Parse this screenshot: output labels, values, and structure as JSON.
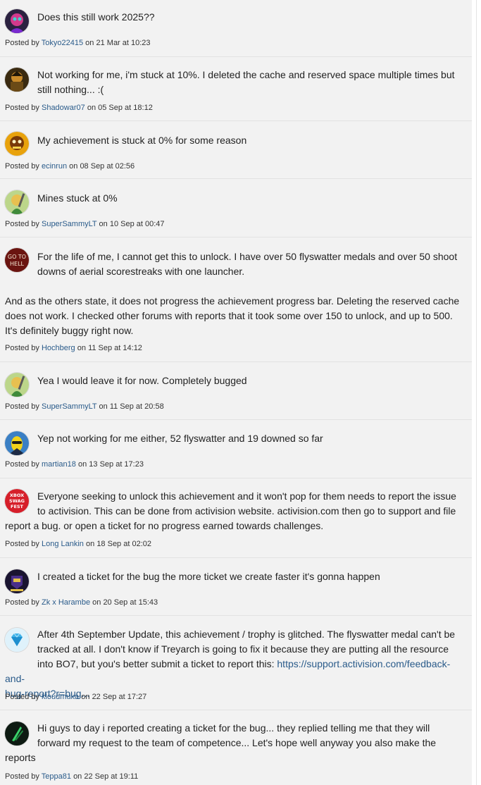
{
  "posted_by_prefix": "Posted by",
  "on_word": "on",
  "comments": [
    {
      "user": "Tokyo22415",
      "date": "21 Mar at 10:23",
      "avatar_icon": "anime-character-avatar-icon",
      "line1": "Does this still work 2025??"
    },
    {
      "user": "Shadowar07",
      "date": "05 Sep at 18:12",
      "avatar_icon": "soldier-avatar-icon",
      "line1": "Not working for me, i'm stuck at 10%. I deleted the cache and reserved space multiple times but",
      "line2": "still nothing... :("
    },
    {
      "user": "ecinrun",
      "date": "08 Sep at 02:56",
      "avatar_icon": "cartoon-avatar-icon",
      "line1": "My achievement is stuck at 0% for some reason"
    },
    {
      "user": "SuperSammyLT",
      "date": "10 Sep at 00:47",
      "avatar_icon": "warrior-avatar-icon",
      "line1": "Mines stuck at 0%"
    },
    {
      "user": "Hochberg",
      "date": "11 Sep at 14:12",
      "avatar_icon": "go-to-hell-avatar-icon",
      "avatar_text1": "GO TO",
      "avatar_text2": "HELL",
      "line1": "For the life of me, I cannot get this to unlock. I have over 50 flyswatter medals and over 50 shoot",
      "line2": "downs of aerial scorestreaks with one launcher.",
      "line3": "And as the others state, it does not progress the achievement progress bar. Deleting the reserved cache",
      "line4": "does not work. I checked other forums with reports that it took some over 150 to unlock, and up to 500.",
      "line5": "It's definitely buggy right now."
    },
    {
      "user": "SuperSammyLT",
      "date": "11 Sep at 20:58",
      "avatar_icon": "warrior-avatar-icon",
      "line1": "Yea I would leave it for now. Completely bugged"
    },
    {
      "user": "martian18",
      "date": "13 Sep at 17:23",
      "avatar_icon": "alien-avatar-icon",
      "line1": "Yep not working for me either, 52 flyswatter and 19 downed so far"
    },
    {
      "user": "Long Lankin",
      "date": "18 Sep at 02:02",
      "avatar_icon": "xbox-swag-fest-avatar-icon",
      "avatar_text1": "XBOX",
      "avatar_text2": "SWAG",
      "avatar_text3": "FEST",
      "line1": "Everyone seeking to unlock this achievement and it won't pop for them needs to report the issue",
      "line2": "to activision. This can be done from activision website. activision.com then go to support and file",
      "line3": "report a bug. or open a ticket for no progress earned towards challenges."
    },
    {
      "user": "Zk x Harambe",
      "date": "20 Sep at 15:43",
      "avatar_icon": "gamer-badge-avatar-icon",
      "line1": "I created a ticket for the bug the more ticket we create faster it's gonna happen"
    },
    {
      "user": "kloudmuka",
      "date": "22 Sep at 17:27",
      "avatar_icon": "diamond-avatar-icon",
      "line1": "After 4th September Update, this achievement / trophy is glitched. The flyswatter medal can't be",
      "line2": "tracked at all. I don't know if Treyarch is going to fix it because they are putting all the resource",
      "line3_before_link": "into BO7, but you's better submit a ticket to report this:",
      "link_part1": "https://support.activision.com/feedback-and-",
      "link_part2": "bug-report?r=bug..."
    },
    {
      "user": "Teppa81",
      "date": "22 Sep at 19:11",
      "avatar_icon": "green-emblem-avatar-icon",
      "line1": "Hi guys to day i reported creating a ticket for the bug... they replied telling me that they will",
      "line2": "forward my request to the team of competence... Let's hope well anyway you also make the",
      "line3": "reports"
    }
  ]
}
